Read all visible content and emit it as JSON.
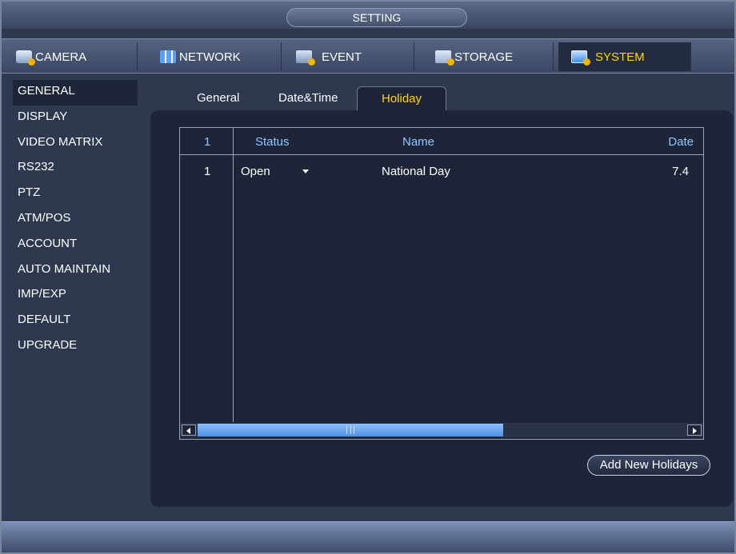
{
  "window": {
    "title": "SETTING"
  },
  "topmenu": {
    "items": [
      {
        "label": "CAMERA",
        "icon": "camera-icon"
      },
      {
        "label": "NETWORK",
        "icon": "network-icon"
      },
      {
        "label": "EVENT",
        "icon": "event-icon"
      },
      {
        "label": "STORAGE",
        "icon": "storage-icon"
      },
      {
        "label": "SYSTEM",
        "icon": "system-icon",
        "active": true
      }
    ]
  },
  "sidebar": {
    "items": [
      {
        "label": "GENERAL",
        "active": true
      },
      {
        "label": "DISPLAY"
      },
      {
        "label": "VIDEO MATRIX"
      },
      {
        "label": "RS232"
      },
      {
        "label": "PTZ"
      },
      {
        "label": "ATM/POS"
      },
      {
        "label": "ACCOUNT"
      },
      {
        "label": "AUTO MAINTAIN"
      },
      {
        "label": "IMP/EXP"
      },
      {
        "label": "DEFAULT"
      },
      {
        "label": "UPGRADE"
      }
    ]
  },
  "tabs": [
    {
      "label": "General"
    },
    {
      "label": "Date&Time"
    },
    {
      "label": "Holiday",
      "active": true
    }
  ],
  "table": {
    "headers": {
      "index": "1",
      "status": "Status",
      "name": "Name",
      "date": "Date"
    },
    "rows": [
      {
        "index": "1",
        "status": "Open",
        "name": "National Day",
        "date": "7.4"
      }
    ]
  },
  "buttons": {
    "add_new": "Add New Holidays"
  },
  "colors": {
    "accent_active": "#ffd700",
    "header_text": "#8fc8ff",
    "scroll_thumb": "#4d8fe4"
  }
}
